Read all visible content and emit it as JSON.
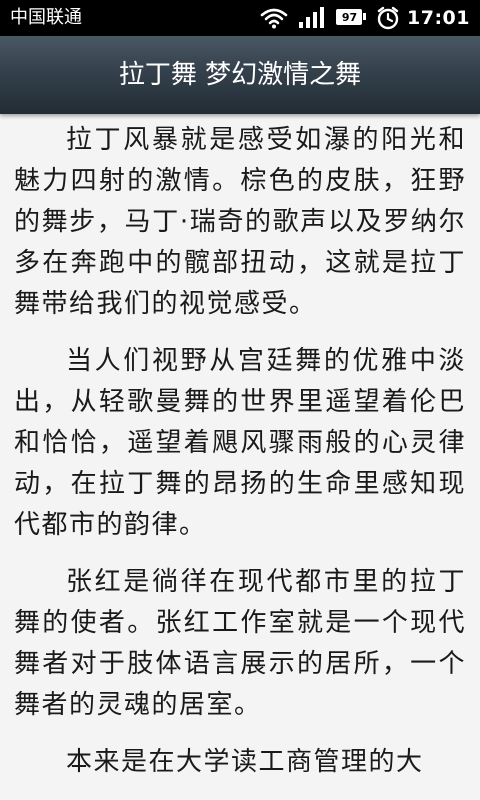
{
  "status_bar": {
    "carrier": "中国联通",
    "battery_level": "97",
    "time": "17:01",
    "icons": [
      "wifi-icon",
      "signal-icon",
      "battery-icon",
      "alarm-icon"
    ]
  },
  "title_bar": {
    "title": "拉丁舞 梦幻激情之舞"
  },
  "article": {
    "paragraphs": [
      "拉丁风暴就是感受如瀑的阳光和魅力四射的激情。棕色的皮肤，狂野的舞步，马丁·瑞奇的歌声以及罗纳尔多在奔跑中的髋部扭动，这就是拉丁舞带给我们的视觉感受。",
      "当人们视野从宫廷舞的优雅中淡出，从轻歌曼舞的世界里遥望着伦巴和恰恰，遥望着飓风骤雨般的心灵律动，在拉丁舞的昂扬的生命里感知现代都市的韵律。",
      "张红是徜徉在现代都市里的拉丁舞的使者。张红工作室就是一个现代舞者对于肢体语言展示的居所，一个舞者的灵魂的居室。",
      "本来是在大学读工商管理的大"
    ]
  },
  "colors": {
    "status_bar_bg": "#000000",
    "title_bar_bg": "#34414c",
    "content_bg": "#f4f4f4",
    "text": "#1a1a1a"
  }
}
